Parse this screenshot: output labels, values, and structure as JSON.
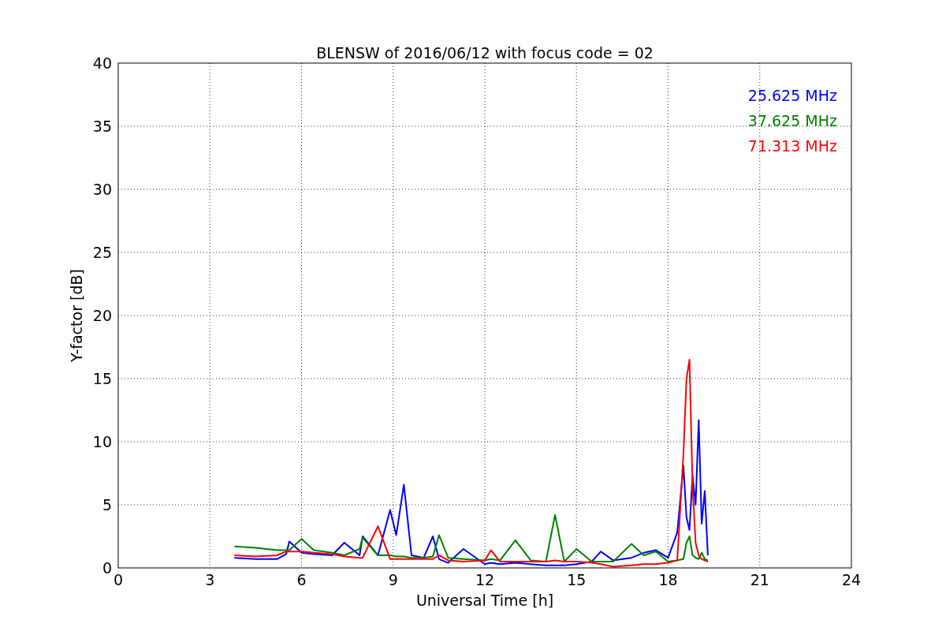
{
  "chart_data": {
    "type": "line",
    "title": "BLENSW of 2016/06/12 with focus code = 02",
    "xlabel": "Universal Time [h]",
    "ylabel": "Y-factor [dB]",
    "grid": true,
    "xlim": [
      0,
      24
    ],
    "ylim": [
      0,
      40
    ],
    "xticks": [
      0,
      3,
      6,
      9,
      12,
      15,
      18,
      21,
      24
    ],
    "yticks": [
      0,
      5,
      10,
      15,
      20,
      25,
      30,
      35,
      40
    ],
    "x": [
      3.8,
      4.5,
      5.2,
      5.5,
      5.6,
      6.0,
      6.4,
      7.0,
      7.4,
      7.9,
      8.0,
      8.5,
      8.9,
      9.1,
      9.35,
      9.6,
      10.0,
      10.3,
      10.5,
      10.8,
      11.3,
      12.0,
      12.2,
      12.5,
      13.0,
      13.5,
      14.0,
      14.3,
      14.6,
      15.0,
      15.5,
      15.8,
      16.2,
      16.8,
      17.2,
      17.6,
      18.0,
      18.3,
      18.5,
      18.6,
      18.7,
      18.8,
      18.9,
      19.0,
      19.1,
      19.2,
      19.3
    ],
    "series": [
      {
        "name": "25.625 MHz",
        "color": "#0000ff",
        "values": [
          0.8,
          0.7,
          0.7,
          1.1,
          2.1,
          1.2,
          1.1,
          1.0,
          2.0,
          1.0,
          2.5,
          1.0,
          4.6,
          2.6,
          6.6,
          1.0,
          0.8,
          2.5,
          0.7,
          0.4,
          1.5,
          0.3,
          0.4,
          0.3,
          0.4,
          0.3,
          0.2,
          0.2,
          0.2,
          0.3,
          0.5,
          1.3,
          0.6,
          0.8,
          1.2,
          1.4,
          0.8,
          2.8,
          8.1,
          4.0,
          3.0,
          7.3,
          5.0,
          11.7,
          3.5,
          6.1,
          1.0
        ]
      },
      {
        "name": "37.625 MHz",
        "color": "#008000",
        "values": [
          1.7,
          1.6,
          1.4,
          1.4,
          1.4,
          2.3,
          1.4,
          1.2,
          1.0,
          1.5,
          2.4,
          1.0,
          1.0,
          0.9,
          0.9,
          0.8,
          0.8,
          0.9,
          2.6,
          0.8,
          0.7,
          0.6,
          0.7,
          0.6,
          2.2,
          0.6,
          0.5,
          4.2,
          0.5,
          1.5,
          0.5,
          0.5,
          0.5,
          1.9,
          1.0,
          1.3,
          0.5,
          0.6,
          0.7,
          2.0,
          2.5,
          1.0,
          0.8,
          0.7,
          1.2,
          0.7,
          0.6
        ]
      },
      {
        "name": "71.313 MHz",
        "color": "#ff0000",
        "values": [
          1.0,
          0.9,
          1.0,
          1.3,
          1.3,
          1.3,
          1.2,
          1.1,
          0.9,
          0.8,
          0.8,
          3.3,
          0.7,
          0.7,
          0.7,
          0.7,
          0.7,
          0.7,
          1.0,
          0.6,
          0.5,
          0.6,
          1.4,
          0.5,
          0.5,
          0.5,
          0.5,
          0.6,
          0.5,
          0.5,
          0.4,
          0.3,
          0.1,
          0.2,
          0.3,
          0.3,
          0.4,
          0.6,
          9.0,
          15.0,
          16.5,
          6.5,
          2.0,
          1.0,
          0.7,
          0.6,
          0.5
        ]
      }
    ]
  }
}
